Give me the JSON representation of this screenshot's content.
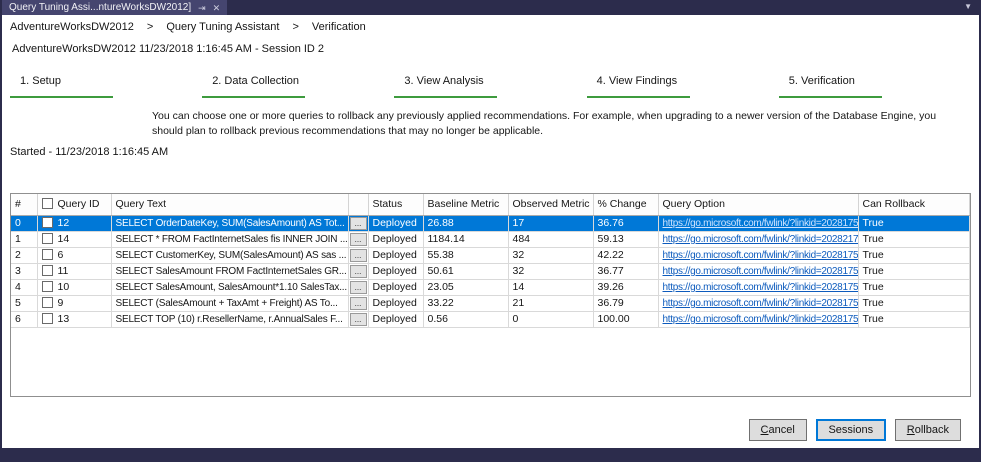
{
  "colors": {
    "chrome_bar": "#2c2c4c",
    "active_tab": "#45456f",
    "selected_row_blue": "#0078d7",
    "step_underline_green": "#3e9b3e",
    "link_blue": "#0d5bbd",
    "focus_border_blue": "#0078d7"
  },
  "tab_bar": {
    "tab_title": "Query Tuning Assi...ntureWorksDW2012]",
    "pin_icon": "⇥",
    "close_icon": "✕",
    "overflow_icon": "▼"
  },
  "breadcrumb": {
    "separator": ">",
    "items": [
      "AdventureWorksDW2012",
      "Query Tuning Assistant",
      "Verification"
    ]
  },
  "session_header": "AdventureWorksDW2012 11/23/2018 1:16:45 AM - Session ID 2",
  "steps": [
    {
      "label": "1. Setup"
    },
    {
      "label": "2. Data Collection"
    },
    {
      "label": "3. View Analysis"
    },
    {
      "label": "4. View Findings"
    },
    {
      "label": "5. Verification"
    }
  ],
  "description": "You can choose one or more queries to rollback any previously applied recommendations. For example, when upgrading to a newer version of the Database Engine, you should plan to rollback previous recommendations that may no longer be applicable.",
  "started_text": "Started - 11/23/2018 1:16:45 AM",
  "grid": {
    "ellipsis_label": "...",
    "headers": {
      "index": "#",
      "query_id": "Query ID",
      "query_text": "Query Text",
      "ellipsis": "",
      "status": "Status",
      "baseline": "Baseline Metric",
      "observed": "Observed Metric",
      "change": "% Change",
      "option": "Query Option",
      "rollback": "Can Rollback"
    },
    "rows": [
      {
        "selected": true,
        "index": "0",
        "query_id": "12",
        "query_text": "SELECT OrderDateKey, SUM(SalesAmount) AS Tot...",
        "status": "Deployed",
        "baseline": "26.88",
        "observed": "17",
        "change": "36.76",
        "option": "https://go.microsoft.com/fwlink/?linkid=2028175",
        "rollback": "True"
      },
      {
        "selected": false,
        "index": "1",
        "query_id": "14",
        "query_text": "SELECT * FROM FactInternetSales fis INNER JOIN ...",
        "status": "Deployed",
        "baseline": "1184.14",
        "observed": "484",
        "change": "59.13",
        "option": "https://go.microsoft.com/fwlink/?linkid=2028217",
        "rollback": "True"
      },
      {
        "selected": false,
        "index": "2",
        "query_id": "6",
        "query_text": "SELECT CustomerKey, SUM(SalesAmount) AS sas ...",
        "status": "Deployed",
        "baseline": "55.38",
        "observed": "32",
        "change": "42.22",
        "option": "https://go.microsoft.com/fwlink/?linkid=2028175",
        "rollback": "True"
      },
      {
        "selected": false,
        "index": "3",
        "query_id": "11",
        "query_text": "SELECT SalesAmount FROM FactInternetSales GR...",
        "status": "Deployed",
        "baseline": "50.61",
        "observed": "32",
        "change": "36.77",
        "option": "https://go.microsoft.com/fwlink/?linkid=2028175",
        "rollback": "True"
      },
      {
        "selected": false,
        "index": "4",
        "query_id": "10",
        "query_text": "SELECT SalesAmount, SalesAmount*1.10 SalesTax...",
        "status": "Deployed",
        "baseline": "23.05",
        "observed": "14",
        "change": "39.26",
        "option": "https://go.microsoft.com/fwlink/?linkid=2028175",
        "rollback": "True"
      },
      {
        "selected": false,
        "index": "5",
        "query_id": "9",
        "query_text": "SELECT (SalesAmount + TaxAmt + Freight) AS To...",
        "status": "Deployed",
        "baseline": "33.22",
        "observed": "21",
        "change": "36.79",
        "option": "https://go.microsoft.com/fwlink/?linkid=2028175",
        "rollback": "True"
      },
      {
        "selected": false,
        "index": "6",
        "query_id": "13",
        "query_text": "SELECT TOP (10) r.ResellerName, r.AnnualSales  F...",
        "status": "Deployed",
        "baseline": "0.56",
        "observed": "0",
        "change": "100.00",
        "option": "https://go.microsoft.com/fwlink/?linkid=2028175",
        "rollback": "True"
      }
    ]
  },
  "buttons": {
    "cancel": {
      "key": "C",
      "rest": "ancel"
    },
    "sessions": {
      "key": "",
      "rest": "Sessions"
    },
    "rollback": {
      "key": "R",
      "rest": "ollback"
    }
  }
}
